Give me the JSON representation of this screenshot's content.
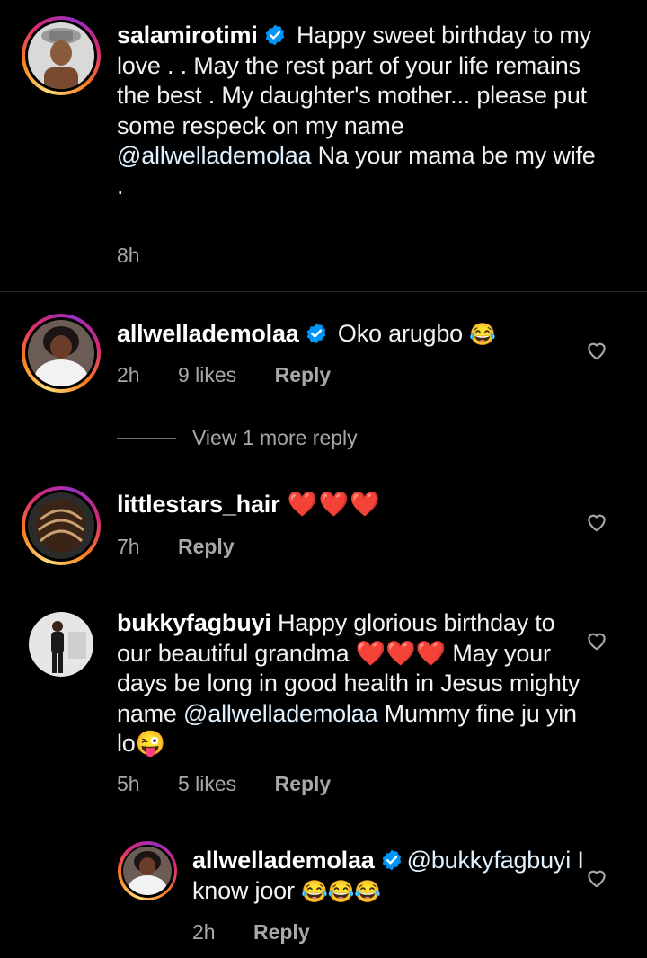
{
  "comments": [
    {
      "username": "salamirotimi",
      "text_before": " Happy sweet birthday to my love . . May the rest part of your life remains the best . My daughter's mother... please put some respeck on my name ",
      "mention": "@allwellademolaa",
      "text_after": " Na your mama be my wife .",
      "time": "8h"
    },
    {
      "username": "allwellademolaa",
      "text": " Oko arugbo ",
      "emoji": "😂",
      "time": "2h",
      "likes": "9 likes",
      "reply": "Reply"
    },
    {
      "username": "littlestars_hair",
      "text": " ❤️❤️❤️",
      "time": "7h",
      "reply": "Reply"
    },
    {
      "username": "bukkyfagbuyi",
      "text_before": " Happy glorious birthday to our beautiful grandma ❤️❤️❤️ May your days be long in good health in Jesus mighty name ",
      "mention": "@allwellademolaa",
      "text_after": " Mummy fine ju yin lo😜",
      "time": "5h",
      "likes": "5 likes",
      "reply": "Reply"
    },
    {
      "username": "allwellademolaa",
      "mention": "@bukkyfagbuyi",
      "text_after": " I know joor ",
      "emoji": "😂😂😂",
      "time": "2h",
      "reply": "Reply"
    }
  ],
  "view_more_replies": "View 1 more reply",
  "colors": {
    "verified": "#0095f6",
    "mention": "#e0f1ff",
    "muted": "#a8a8a8"
  },
  "icons": [
    "verified-badge-icon",
    "heart-outline-icon"
  ]
}
